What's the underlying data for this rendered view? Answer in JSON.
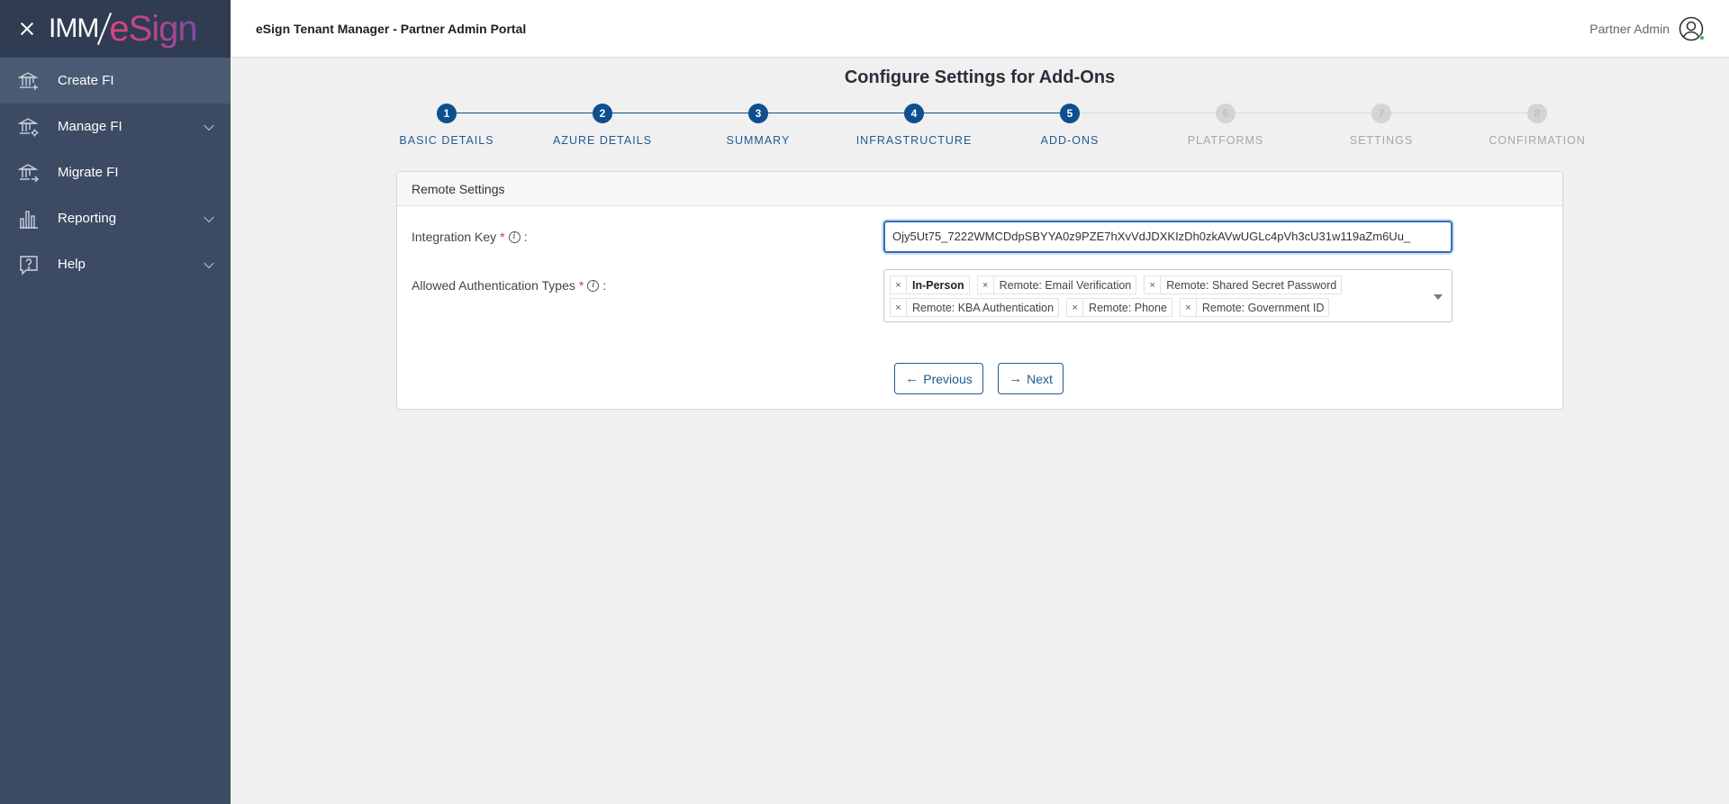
{
  "sidebar": {
    "logo": {
      "imm": "IMM",
      "esign": "eSign"
    },
    "items": [
      {
        "label": "Create FI",
        "icon": "bank-plus-icon",
        "active": true,
        "has_submenu": false
      },
      {
        "label": "Manage FI",
        "icon": "bank-gear-icon",
        "active": false,
        "has_submenu": true
      },
      {
        "label": "Migrate FI",
        "icon": "bank-arrow-icon",
        "active": false,
        "has_submenu": false
      },
      {
        "label": "Reporting",
        "icon": "bar-chart-icon",
        "active": false,
        "has_submenu": true
      },
      {
        "label": "Help",
        "icon": "help-icon",
        "active": false,
        "has_submenu": true
      }
    ]
  },
  "header": {
    "title": "eSign Tenant Manager - Partner Admin Portal",
    "user_name": "Partner Admin"
  },
  "page": {
    "title": "Configure Settings for Add-Ons"
  },
  "stepper": {
    "current": 5,
    "steps": [
      {
        "number": "1",
        "label": "BASIC DETAILS"
      },
      {
        "number": "2",
        "label": "AZURE DETAILS"
      },
      {
        "number": "3",
        "label": "SUMMARY"
      },
      {
        "number": "4",
        "label": "INFRASTRUCTURE"
      },
      {
        "number": "5",
        "label": "ADD-ONS"
      },
      {
        "number": "6",
        "label": "PLATFORMS"
      },
      {
        "number": "7",
        "label": "SETTINGS"
      },
      {
        "number": "8",
        "label": "CONFIRMATION"
      }
    ]
  },
  "form": {
    "section_title": "Remote Settings",
    "integration_key": {
      "label": "Integration Key",
      "value": "Ojy5Ut75_7222WMCDdpSBYYA0z9PZE7hXvVdJDXKIzDh0zkAVwUGLc4pVh3cU31w119aZm6Uu_"
    },
    "auth_types": {
      "label": "Allowed Authentication Types",
      "selected": [
        [
          "In-Person",
          "Remote: Email Verification",
          "Remote: Shared Secret Password"
        ],
        [
          "Remote: KBA Authentication",
          "Remote: Phone",
          "Remote: Government ID"
        ]
      ]
    },
    "required_mark": "*",
    "info_glyph": "i",
    "colon": ":"
  },
  "buttons": {
    "previous": "Previous",
    "next": "Next"
  },
  "colors": {
    "sidebar_bg": "#3c4b63",
    "accent": "#1f5a94",
    "step_done": "#0d4f8f"
  }
}
